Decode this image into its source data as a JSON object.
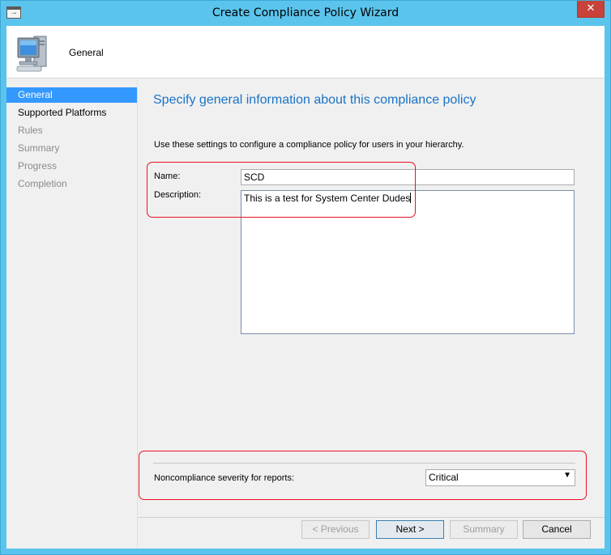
{
  "window": {
    "title": "Create Compliance Policy Wizard",
    "close_glyph": "✕"
  },
  "header": {
    "title": "General",
    "icon": "computer-icon"
  },
  "nav": {
    "items": [
      {
        "label": "General",
        "state": "active"
      },
      {
        "label": "Supported Platforms",
        "state": "done"
      },
      {
        "label": "Rules",
        "state": "pending"
      },
      {
        "label": "Summary",
        "state": "pending"
      },
      {
        "label": "Progress",
        "state": "pending"
      },
      {
        "label": "Completion",
        "state": "pending"
      }
    ]
  },
  "page": {
    "heading": "Specify general information about this compliance policy",
    "intro": "Use these settings to configure a compliance policy for users in your hierarchy.",
    "name_label": "Name:",
    "name_value": "SCD",
    "description_label": "Description:",
    "description_value": "This is a test for System Center Dudes",
    "severity_label": "Noncompliance severity for reports:",
    "severity_value": "Critical"
  },
  "buttons": {
    "previous": "< Previous",
    "next": "Next >",
    "summary": "Summary",
    "cancel": "Cancel"
  },
  "colors": {
    "titlebar": "#5bc4ec",
    "accent": "#3399ff",
    "heading": "#1a73c6",
    "highlight": "#e81123"
  }
}
